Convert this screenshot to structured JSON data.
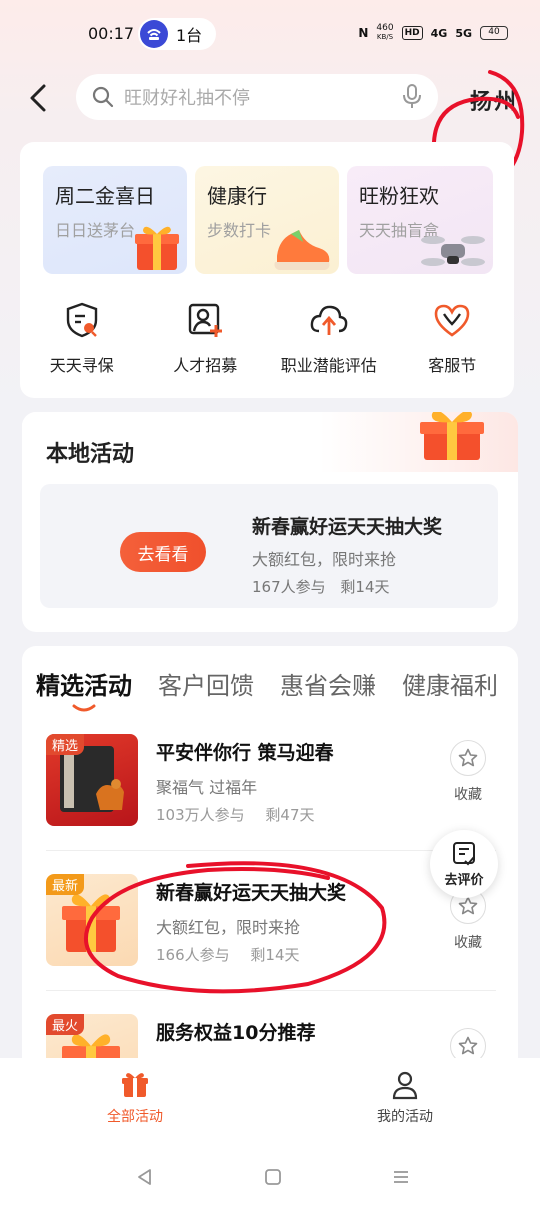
{
  "status_bar": {
    "time": "00:17",
    "devices_label": "1台",
    "net_speed": "460",
    "net_unit": "KB/S",
    "hd_badge": "HD",
    "signal_1": "4G",
    "signal_2": "5G",
    "battery": "40"
  },
  "header": {
    "search_placeholder": "旺财好礼抽不停",
    "city": "扬州"
  },
  "promos": [
    {
      "title": "周二金喜日",
      "subtitle": "日日送茅台"
    },
    {
      "title": "健康行",
      "subtitle": "步数打卡"
    },
    {
      "title": "旺粉狂欢",
      "subtitle": "天天抽盲盒"
    }
  ],
  "shortcuts": [
    {
      "label": "天天寻保",
      "icon": "shield-search-icon"
    },
    {
      "label": "人才招募",
      "icon": "person-add-icon"
    },
    {
      "label": "职业潜能评估",
      "icon": "cloud-arrow-icon"
    },
    {
      "label": "客服节",
      "icon": "heart-hands-icon"
    }
  ],
  "local": {
    "title": "本地活动",
    "item": {
      "button": "去看看",
      "name": "新春赢好运天天抽大奖",
      "subtitle": "大额红包，限时来抢",
      "participants": "167人参与",
      "remaining": "剩14天"
    }
  },
  "featured": {
    "tabs": [
      "精选活动",
      "客户回馈",
      "惠省会赚",
      "健康福利"
    ],
    "items": [
      {
        "badge": "精选",
        "name": "平安伴你行 策马迎春",
        "subtitle": "聚福气 过福年",
        "participants": "103万人参与",
        "remaining": "剩47天",
        "fav": "收藏"
      },
      {
        "badge": "最新",
        "name": "新春赢好运天天抽大奖",
        "subtitle": "大额红包，限时来抢",
        "participants": "166人参与",
        "remaining": "剩14天",
        "fav": "收藏"
      },
      {
        "badge": "最火",
        "name": "服务权益10分推荐",
        "subtitle": "",
        "participants": "",
        "remaining": "",
        "fav": "收藏"
      }
    ],
    "review_button": "去评价"
  },
  "bottom_nav": {
    "all": "全部活动",
    "mine": "我的活动"
  },
  "colors": {
    "accent": "#f05a2b",
    "annotation": "#e8112a"
  }
}
